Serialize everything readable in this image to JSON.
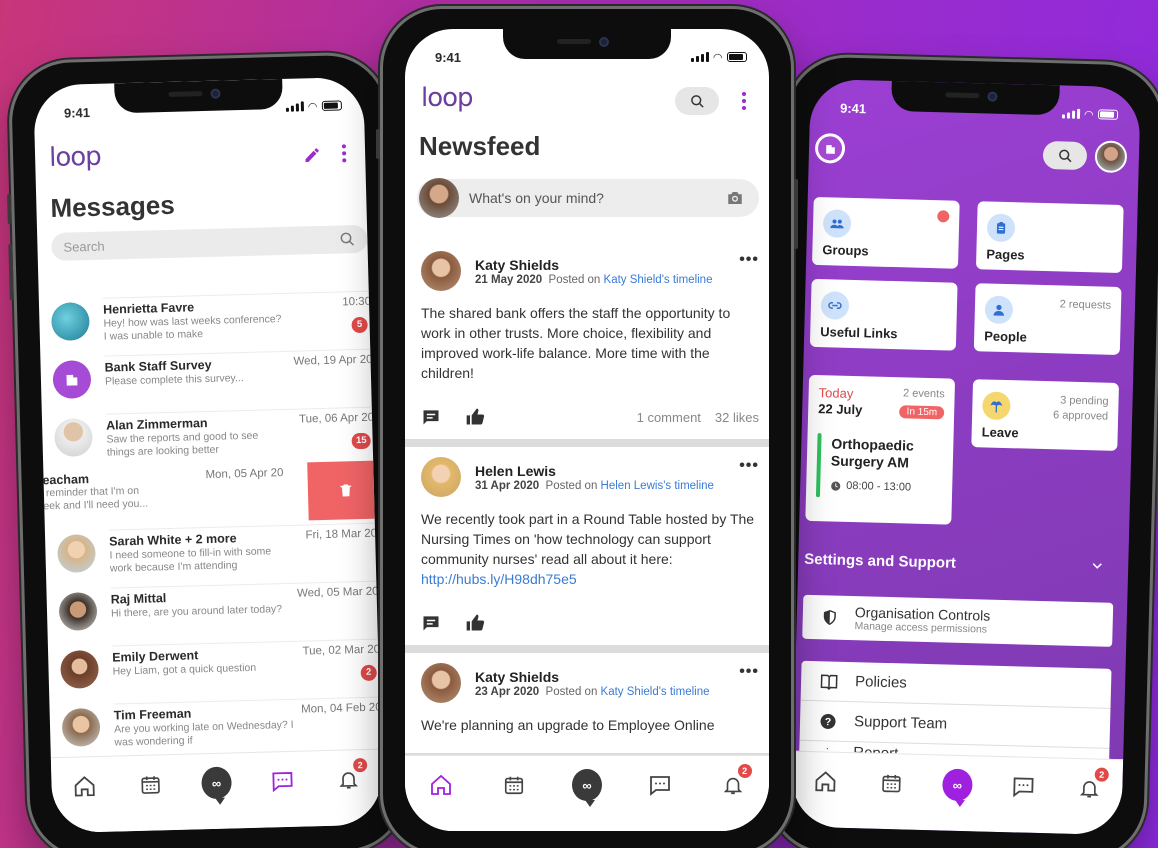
{
  "status_time": "9:41",
  "logo": "loop",
  "tabbar_badge": "2",
  "colors": {
    "brand_purple": "#a020e0",
    "badge_red": "#e24a4a",
    "link_blue": "#3a7bd5"
  },
  "messages": {
    "title": "Messages",
    "search_placeholder": "Search",
    "items": [
      {
        "name": "Henrietta Favre",
        "date": "10:30",
        "preview": "Hey! how was last weeks conference? I was unable to make",
        "badge": "5",
        "avatar_color": "#2a9fb8"
      },
      {
        "name": "Bank Staff Survey",
        "date": "Wed, 19 Apr 20",
        "preview": "Please complete this survey...",
        "badge": "",
        "avatar_color": "#a64bd6"
      },
      {
        "name": "Alan Zimmerman",
        "date": "Tue, 06 Apr 20",
        "preview": "Saw the reports and good to see things are looking better",
        "badge": "15",
        "avatar_color": "#c9c9c9"
      },
      {
        "name": "Angela Meacham",
        "name_visible": "gela Meacham",
        "date": "Mon, 05 Apr 20",
        "preview": "t a quick reminder that I'm on\ne next week and I'll need you...",
        "badge": "",
        "avatar_color": "#ffffff"
      },
      {
        "name": "Sarah White + 2 more",
        "date": "Fri, 18 Mar 20",
        "preview": "I need someone to fill-in with some work because I'm attending",
        "badge": "",
        "avatar_color": "#d8b48a"
      },
      {
        "name": "Raj Mittal",
        "date": "Wed, 05 Mar 20",
        "preview": "Hi there, are you around later today?",
        "badge": "",
        "avatar_color": "#5a4a3e"
      },
      {
        "name": "Emily Derwent",
        "date": "Tue, 02 Mar 20",
        "preview": "Hey Liam, got a quick question",
        "badge": "2",
        "avatar_color": "#7a4a34"
      },
      {
        "name": "Tim Freeman",
        "date": "Mon, 04 Feb 20",
        "preview": "Are you working late on Wednesday? I was wondering if",
        "badge": "",
        "avatar_color": "#a88060"
      }
    ]
  },
  "newsfeed": {
    "title": "Newsfeed",
    "post_placeholder": "What's on your mind?",
    "posts": [
      {
        "name": "Katy Shields",
        "date": "21 May 2020",
        "posted_on": "Posted on",
        "timeline": "Katy Shield's timeline",
        "text": "The shared bank offers the staff the opportunity to work in other trusts. More choice, flexibility and improved work-life balance. More time with the children!",
        "link": "",
        "comments": "1 comment",
        "likes": "32 likes"
      },
      {
        "name": "Helen Lewis",
        "date": "31 Apr 2020",
        "posted_on": "Posted on",
        "timeline": "Helen Lewis's timeline",
        "text": "We recently took part in a Round Table hosted by The Nursing Times on 'how technology can support community nurses' read all about it here: ",
        "link": "http://hubs.ly/H98dh75e5",
        "comments": "",
        "likes": ""
      },
      {
        "name": "Katy Shields",
        "date": "23 Apr 2020",
        "posted_on": "Posted on",
        "timeline": "Katy Shield's timeline",
        "text": "We're planning an upgrade to Employee Online",
        "link": "",
        "comments": "",
        "likes": ""
      }
    ]
  },
  "dashboard": {
    "groups": "Groups",
    "pages": "Pages",
    "useful_links": "Useful Links",
    "people": "People",
    "people_sub": "2 requests",
    "today": "Today",
    "date": "22 July",
    "events": "2 events",
    "in_time": "In 15m",
    "event_title": "Orthopaedic Surgery AM",
    "event_time": "08:00 - 13:00",
    "leave": "Leave",
    "leave_pending": "3 pending",
    "leave_approved": "6 approved",
    "settings_title": "Settings and Support",
    "org_controls": "Organisation Controls",
    "org_controls_sub": "Manage access permissions",
    "policies": "Policies",
    "support_team": "Support Team",
    "report": "Report"
  }
}
